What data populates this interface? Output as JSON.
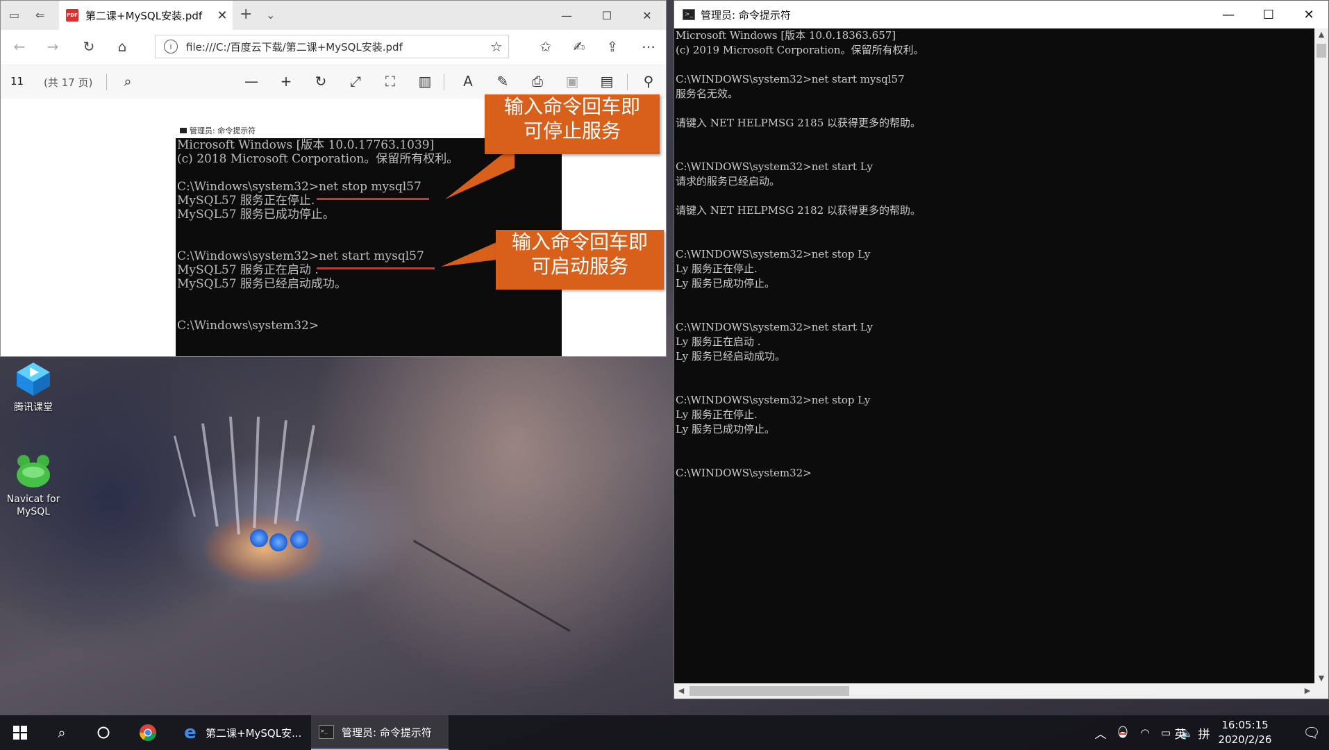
{
  "edge": {
    "tab_title": "第二课+MySQL安装.pdf",
    "url": "file:///C:/百度云下载/第二课+MySQL安装.pdf",
    "page_number": "11",
    "page_total": "(共 17 页)",
    "embedded": {
      "window_title": "管理员: 命令提示符",
      "lines": "Microsoft Windows [版本 10.0.17763.1039]\n(c) 2018 Microsoft Corporation。保留所有权利。\n\nC:\\Windows\\system32>net stop mysql57\nMySQL57 服务正在停止.\nMySQL57 服务已成功停止。\n\n\nC:\\Windows\\system32>net start mysql57\nMySQL57 服务正在启动 .\nMySQL57 服务已经启动成功。\n\n\nC:\\Windows\\system32>",
      "callout_stop": "输入命令回车即\n可停止服务",
      "callout_start": "输入命令回车即\n可启动服务"
    }
  },
  "cmd": {
    "title": "管理员: 命令提示符",
    "lines": "Microsoft Windows [版本 10.0.18363.657]\n(c) 2019 Microsoft Corporation。保留所有权利。\n\nC:\\WINDOWS\\system32>net start mysql57\n服务名无效。\n\n请键入 NET HELPMSG 2185 以获得更多的帮助。\n\n\nC:\\WINDOWS\\system32>net start Ly\n请求的服务已经启动。\n\n请键入 NET HELPMSG 2182 以获得更多的帮助。\n\n\nC:\\WINDOWS\\system32>net stop Ly\nLy 服务正在停止.\nLy 服务已成功停止。\n\n\nC:\\WINDOWS\\system32>net start Ly\nLy 服务正在启动 .\nLy 服务已经启动成功。\n\n\nC:\\WINDOWS\\system32>net stop Ly\nLy 服务正在停止.\nLy 服务已成功停止。\n\n\nC:\\WINDOWS\\system32>"
  },
  "desktop": {
    "icons": [
      {
        "label": "腾讯课堂"
      },
      {
        "label": "Navicat for\nMySQL"
      }
    ]
  },
  "taskbar": {
    "apps": [
      {
        "label": "第二课+MySQL安..."
      },
      {
        "label": "管理员: 命令提示符"
      }
    ],
    "ime_lang": "英",
    "ime_mode": "拼",
    "time": "16:05:15",
    "date": "2020/2/26"
  },
  "colors": {
    "callout": "#d9601a",
    "underline": "#e0301e",
    "console_bg": "#0c0c0c",
    "console_text": "#cccccc"
  }
}
